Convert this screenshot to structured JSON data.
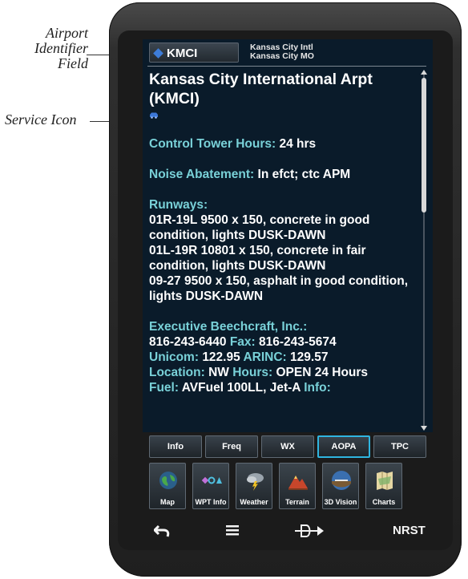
{
  "callouts": {
    "airport_identifier_field": "Airport\nIdentifier\nField",
    "service_icon": "Service Icon"
  },
  "header": {
    "identifier": "KMCI",
    "airport_name_line1": "Kansas City Intl",
    "airport_name_line2": "Kansas City MO"
  },
  "content": {
    "title": "Kansas City International Arpt (KMCI)",
    "service_icon": "service-icon",
    "control_tower_label": "Control Tower Hours:",
    "control_tower_value": "24 hrs",
    "noise_label": "Noise Abatement:",
    "noise_value": "In efct; ctc APM",
    "runways_label": "Runways:",
    "runways": [
      "01R-19L 9500 x 150, concrete in good condition, lights DUSK-DAWN",
      "01L-19R 10801 x 150, concrete in fair condition, lights DUSK-DAWN",
      "09-27 9500 x 150, asphalt in good condition, lights DUSK-DAWN"
    ],
    "fbo_name": "Executive Beechcraft, Inc.:",
    "phone": "816-243-6440",
    "fax_label": "Fax:",
    "fax": "816-243-5674",
    "unicom_label": "Unicom:",
    "unicom": "122.95",
    "arinc_label": "ARINC:",
    "arinc": "129.57",
    "location_label": "Location:",
    "location": "NW",
    "hours_label": "Hours:",
    "hours": "OPEN 24 Hours",
    "fuel_label": "Fuel:",
    "fuel": "AVFuel 100LL, Jet-A",
    "info_label": "Info:"
  },
  "tabs": [
    {
      "label": "Info",
      "active": false
    },
    {
      "label": "Freq",
      "active": false
    },
    {
      "label": "WX",
      "active": false
    },
    {
      "label": "AOPA",
      "active": true
    },
    {
      "label": "TPC",
      "active": false
    }
  ],
  "apps": [
    {
      "label": "Map",
      "icon": "map-icon"
    },
    {
      "label": "WPT Info",
      "icon": "waypoint-info-icon"
    },
    {
      "label": "Weather",
      "icon": "weather-icon"
    },
    {
      "label": "Terrain",
      "icon": "terrain-icon"
    },
    {
      "label": "3D Vision",
      "icon": "3d-vision-icon"
    },
    {
      "label": "Charts",
      "icon": "charts-icon"
    }
  ],
  "nav": {
    "back_icon": "back-arrow-icon",
    "menu_icon": "menu-icon",
    "direct_to_icon": "direct-to-icon",
    "nrst": "NRST"
  },
  "colors": {
    "label": "#79d1d8",
    "active_tab": "#2fb5e0",
    "screen_bg": "#0a1b2a"
  }
}
